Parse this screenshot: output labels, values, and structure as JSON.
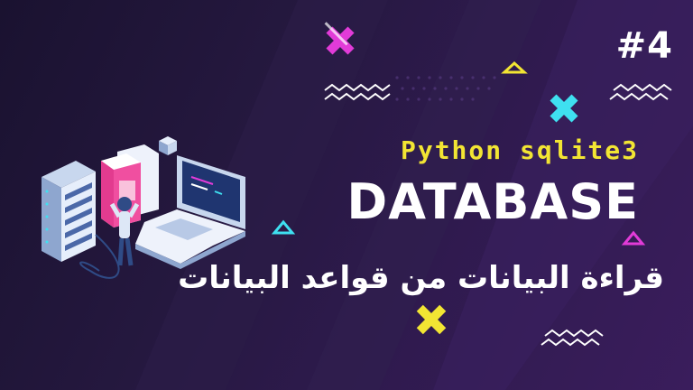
{
  "episode": "#4",
  "subtitle": "Python sqlite3",
  "title": "DATABASE",
  "arabic_title": "قراءة البيانات من قواعد البيانات",
  "colors": {
    "background": "#25183f",
    "subtitle": "#f2e533",
    "title": "#ffffff",
    "magenta_accent": "#e23bd8",
    "cyan_accent": "#3fe0f0",
    "yellow_accent": "#f2e533"
  },
  "icons": [
    "server-rack-icon",
    "database-books-icon",
    "laptop-icon",
    "person-icon",
    "cube-icon",
    "x-mark-icon",
    "triangle-icon",
    "zigzag-icon"
  ]
}
